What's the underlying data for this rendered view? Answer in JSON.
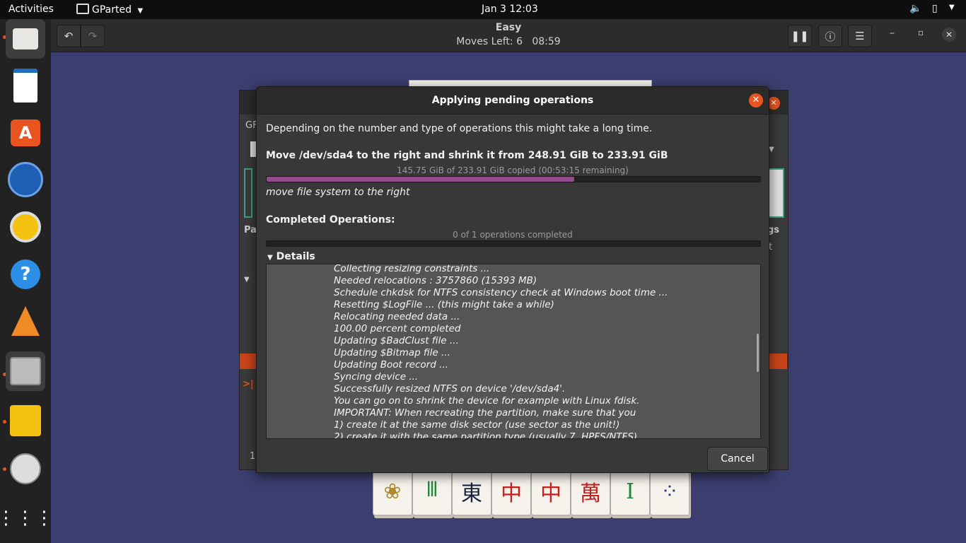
{
  "topbar": {
    "activities": "Activities",
    "app_name": "GParted",
    "clock": "Jan 3  12:03"
  },
  "game": {
    "title": "Easy",
    "moves_label": "Moves Left:  6",
    "timer": "08:59"
  },
  "gparted_bg": {
    "label_gf": "GF",
    "label_pa": "Pa",
    "label_gs": "gs",
    "label_t": "t",
    "status_digit": "1"
  },
  "dialog": {
    "title": "Applying pending operations",
    "intro": "Depending on the number and type of operations this might take a long time.",
    "current_op": "Move /dev/sda4 to the right and shrink it from 248.91 GiB to 233.91 GiB",
    "current_progress_text": "145.75 GiB of 233.91 GiB copied (00:53:15 remaining)",
    "current_progress_fraction": 0.623,
    "sub_op": "move file system to the right",
    "completed_label": "Completed Operations:",
    "completed_text": "0 of 1 operations completed",
    "completed_fraction": 0,
    "details_label": "Details",
    "details_lines": [
      "Collecting resizing constraints ...",
      "Needed relocations : 3757860 (15393 MB)",
      "Schedule chkdsk for NTFS consistency check at Windows boot time ...",
      "Resetting $LogFile ... (this might take a while)",
      "Relocating needed data ...",
      "100.00 percent completed",
      "Updating $BadClust file ...",
      "Updating $Bitmap file ...",
      "Updating Boot record ...",
      "Syncing device ...",
      "Successfully resized NTFS on device '/dev/sda4'.",
      "You can go on to shrink the device for example with Linux fdisk.",
      "IMPORTANT: When recreating the partition, make sure that you",
      "  1)  create it at the same disk sector (use sector as the unit!)",
      "  2)  create it with the same partition type (usually 7, HPFS/NTFS)"
    ],
    "cancel_label": "Cancel"
  },
  "tiles": [
    "❀",
    "𝍫",
    "東",
    "中",
    "中",
    "萬",
    "I",
    "⁘"
  ],
  "colors": {
    "accent": "#e95420",
    "progress": "#924d8b"
  }
}
